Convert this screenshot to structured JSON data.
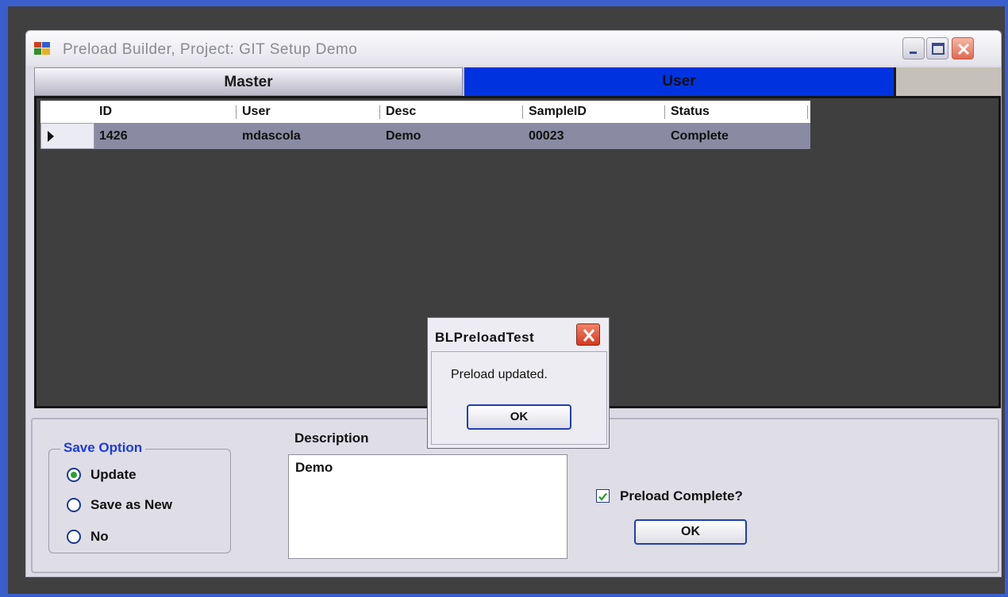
{
  "window": {
    "title": "Preload Builder, Project: GIT Setup Demo"
  },
  "tabs": [
    {
      "label": "Master",
      "active": false
    },
    {
      "label": "User",
      "active": true
    }
  ],
  "grid": {
    "columns": [
      "ID",
      "User",
      "Desc",
      "SampleID",
      "Status"
    ],
    "rows": [
      {
        "ID": "1426",
        "User": "mdascola",
        "Desc": "Demo",
        "SampleID": "00023",
        "Status": "Complete"
      }
    ]
  },
  "save_option": {
    "legend": "Save Option",
    "options": [
      "Update",
      "Save as New",
      "No"
    ],
    "selected": "Update"
  },
  "description": {
    "label": "Description",
    "value": "Demo"
  },
  "preload_complete": {
    "label": "Preload Complete?",
    "checked": true
  },
  "main_ok_label": "OK",
  "dialog": {
    "title": "BLPreloadTest",
    "message": "Preload updated.",
    "ok_label": "OK"
  },
  "colors": {
    "desktop": "#3a5fcd",
    "active_tab": "#0033e0",
    "legend_text": "#1a3ce0",
    "selected_row": "#8a8aa2"
  }
}
